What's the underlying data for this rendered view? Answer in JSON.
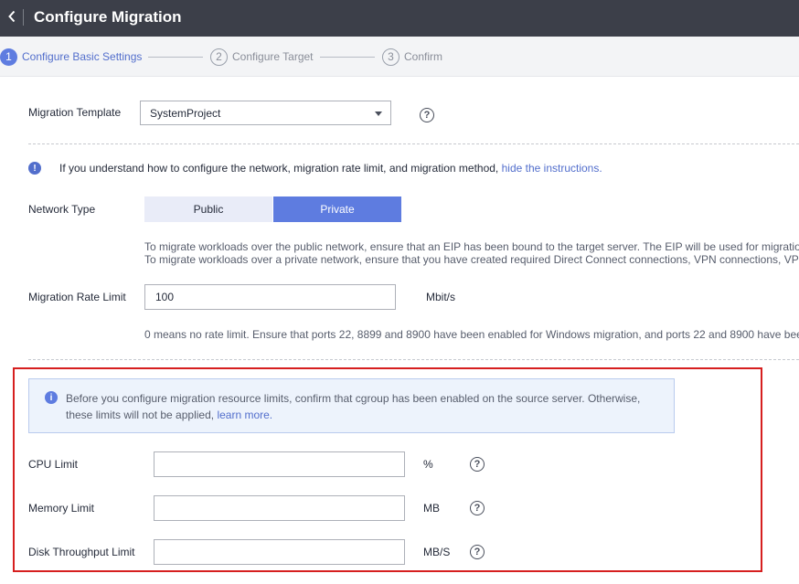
{
  "header": {
    "title": "Configure Migration",
    "back_icon": "chevron-left-icon"
  },
  "steps": [
    {
      "number": "1",
      "label": "Configure Basic Settings",
      "state": "active"
    },
    {
      "number": "2",
      "label": "Configure Target",
      "state": "inactive"
    },
    {
      "number": "3",
      "label": "Confirm",
      "state": "inactive"
    }
  ],
  "template": {
    "label": "Migration Template",
    "value": "SystemProject"
  },
  "instructions": {
    "text": "If you understand how to configure the network, migration rate limit, and migration method,",
    "link": "hide the instructions."
  },
  "network": {
    "label": "Network Type",
    "options": [
      "Public",
      "Private"
    ],
    "selected": "Private",
    "desc_line1": "To migrate workloads over the public network, ensure that an EIP has been bound to the target server. The EIP will be used for migratio",
    "desc_line2": "To migrate workloads over a private network, ensure that you have created required Direct Connect connections, VPN connections, VP"
  },
  "rate_limit": {
    "label": "Migration Rate Limit",
    "value": "100",
    "unit": "Mbit/s",
    "desc": "0 means no rate limit. Ensure that ports 22, 8899 and 8900 have been enabled for Windows migration, and ports 22 and 8900 have bee"
  },
  "resource_notice": {
    "text": "Before you configure migration resource limits, confirm that cgroup has been enabled on the source server. Otherwise, these limits will not be applied,",
    "link": "learn more."
  },
  "cpu": {
    "label": "CPU Limit",
    "value": "",
    "unit": "%"
  },
  "memory": {
    "label": "Memory Limit",
    "value": "",
    "unit": "MB"
  },
  "disk": {
    "label": "Disk Throughput Limit",
    "value": "",
    "unit": "MB/S"
  },
  "colors": {
    "accent": "#5e7ce0",
    "header_bg": "#3c3f49",
    "highlight_border": "#d61f1f"
  }
}
